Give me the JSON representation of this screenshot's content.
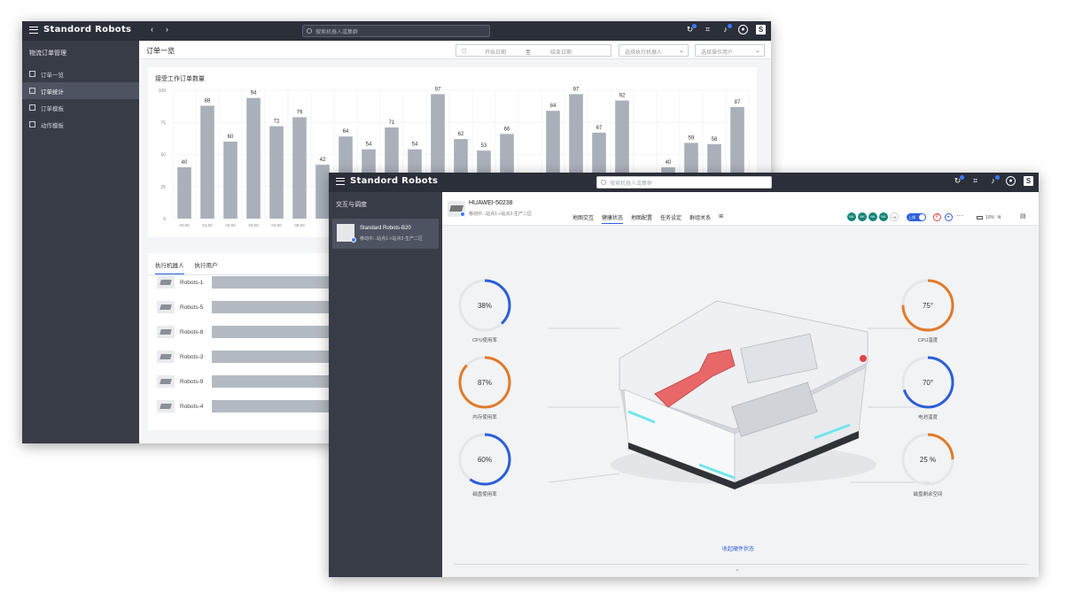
{
  "app": {
    "brand": "Standord Robots",
    "search_placeholder": "搜索机器人或集群"
  },
  "colors": {
    "bar": "#a9b0ba",
    "accent_blue": "#2b5fd9",
    "accent_orange": "#e07a2a",
    "gauge_track": "#e4e6ea"
  },
  "orders_window": {
    "sidebar_title": "物流订单管理",
    "sidebar_items": [
      {
        "label": "订单一览",
        "icon": "list-icon"
      },
      {
        "label": "订单统计",
        "icon": "chart-icon"
      },
      {
        "label": "订单模板",
        "icon": "template-icon"
      },
      {
        "label": "动作模板",
        "icon": "action-icon"
      }
    ],
    "page_title": "订单一览",
    "date_start": "开始日期",
    "date_sep": "至",
    "date_end": "结束日期",
    "robot_select": "选择执行机器人",
    "user_select": "选择操作用户",
    "chart_title": "接受工作订单数量",
    "tabs": [
      "执行机器人",
      "执行用户"
    ],
    "robots": [
      "Robots-1",
      "Robots-5",
      "Robots-8",
      "Robots-3",
      "Robots-9",
      "Robots-4"
    ]
  },
  "chart_data": {
    "type": "bar",
    "title": "接受工作订单数量",
    "ylim": [
      0,
      100
    ],
    "y_ticks": [
      0,
      25,
      50,
      75,
      100
    ],
    "categories": [
      "00:00",
      "01:00",
      "02:00",
      "03:00",
      "04:00",
      "05:00"
    ],
    "values": [
      40,
      88,
      60,
      94,
      72,
      79,
      42,
      64,
      54,
      71,
      54,
      97,
      62,
      53,
      66,
      84,
      97,
      67,
      92,
      40,
      59,
      58,
      87
    ],
    "bar_positions": [
      0,
      1,
      2,
      3,
      4,
      5,
      6,
      7,
      8,
      9,
      10,
      11,
      12,
      13,
      14,
      16,
      17,
      18,
      19,
      21,
      22,
      23,
      24
    ]
  },
  "health_window": {
    "sidebar_title": "交互与调度",
    "robot_item_title": "Standard Robots-B20",
    "robot_item_sub": "移动中...站点1->站点2-生产二区",
    "robot_name": "HUAWEI-50238",
    "robot_status": "移动中...站点1->站点2-生产二区",
    "nav_tabs": [
      "地图交互",
      "健康状态",
      "地图配置",
      "任务设定",
      "群组关系"
    ],
    "active_tab": 1,
    "avatars": [
      "NK",
      "NK",
      "NK",
      "NK",
      "+8"
    ],
    "toggle_label": "上线",
    "battery": "10%",
    "collapse_label": "收起硬件状态",
    "gauges": [
      {
        "label": "CPU使用率",
        "value": 38,
        "display": "38%",
        "color": "#2b5fd9"
      },
      {
        "label": "内存使用率",
        "value": 87,
        "display": "87%",
        "color": "#e07a2a"
      },
      {
        "label": "磁盘使用率",
        "value": 60,
        "display": "60%",
        "color": "#2b5fd9"
      },
      {
        "label": "CPU温度",
        "value": 75,
        "display": "75°",
        "color": "#e07a2a"
      },
      {
        "label": "电池温度",
        "value": 70,
        "display": "70°",
        "color": "#2b5fd9"
      },
      {
        "label": "磁盘剩余空间",
        "value": 25,
        "display": "25 %",
        "color": "#e07a2a"
      }
    ]
  }
}
